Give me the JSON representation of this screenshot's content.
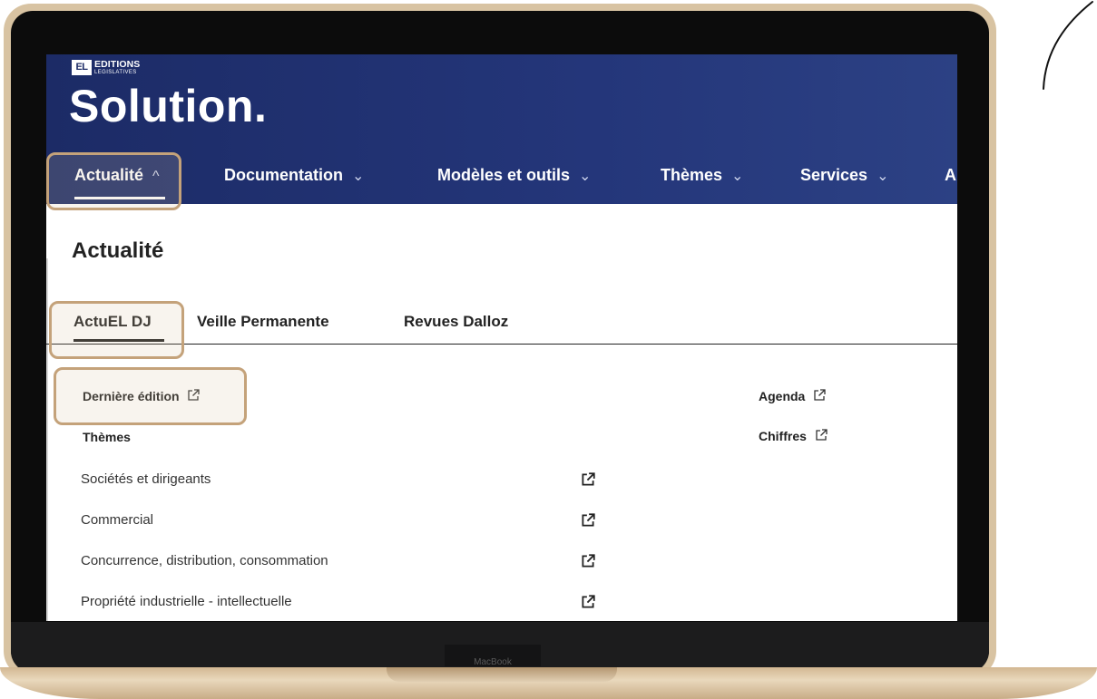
{
  "device": {
    "brand_label": "MacBook"
  },
  "header": {
    "logo_mark": "EL",
    "logo_name": "EDITIONS",
    "logo_subname": "LEGISLATIVES",
    "product_title": "Solution."
  },
  "nav": {
    "items": [
      {
        "label": "Actualité",
        "chevron": "^",
        "active": true
      },
      {
        "label": "Documentation",
        "chevron": "v"
      },
      {
        "label": "Modèles et outils",
        "chevron": "v"
      },
      {
        "label": "Thèmes",
        "chevron": "v"
      },
      {
        "label": "Services",
        "chevron": "v"
      },
      {
        "label": "A",
        "chevron": ""
      }
    ]
  },
  "main": {
    "title": "Actualité",
    "tabs": [
      {
        "label": "ActuEL DJ",
        "active": true
      },
      {
        "label": "Veille Permanente"
      },
      {
        "label": "Revues Dalloz"
      }
    ],
    "left_links": {
      "derniere_edition": "Dernière édition",
      "themes_heading": "Thèmes"
    },
    "right_links": {
      "agenda": "Agenda",
      "chiffres": "Chiffres"
    },
    "themes": [
      "Sociétés et dirigeants",
      "Commercial",
      "Concurrence, distribution, consommation",
      "Propriété industrielle - intellectuelle"
    ]
  },
  "icons": {
    "external_link": "external-link-icon",
    "chevron_up": "chevron-up-icon",
    "chevron_down": "chevron-down-icon"
  },
  "colors": {
    "header_blue": "#24367a",
    "highlight": "#c4a27a",
    "laptop_gold": "#d8c3a2"
  }
}
